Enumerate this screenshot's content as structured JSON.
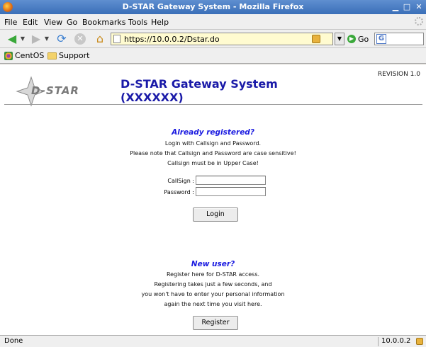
{
  "window": {
    "title": "D-STAR Gateway System - Mozilla Firefox",
    "min_glyph": "▁",
    "max_glyph": "□",
    "close_glyph": "✕"
  },
  "menu": {
    "items": [
      {
        "label": "File",
        "key": "F"
      },
      {
        "label": "Edit",
        "key": "E"
      },
      {
        "label": "View",
        "key": "V"
      },
      {
        "label": "Go",
        "key": "G"
      },
      {
        "label": "Bookmarks",
        "key": "B"
      },
      {
        "label": "Tools",
        "key": "T"
      },
      {
        "label": "Help",
        "key": "H"
      }
    ]
  },
  "toolbar": {
    "url": "https://10.0.0.2/Dstar.do",
    "go_label": "Go",
    "search_glyph": "G"
  },
  "bookmarks": [
    {
      "label": "CentOS",
      "icon": "centos-icon"
    },
    {
      "label": "Support",
      "icon": "folder-icon"
    }
  ],
  "page": {
    "logo_text": "D-STAR",
    "title": "D-STAR Gateway System (XXXXXX)",
    "revision": "REVISION 1.0",
    "login": {
      "heading": "Already registered?",
      "line1": "Login with Callsign and Password.",
      "line2": "Please note that Callsign and Password are case sensitive!",
      "line3": "Callsign must be in Upper Case!",
      "callsign_label": "CallSign :",
      "callsign_value": "",
      "password_label": "Password :",
      "password_value": "",
      "button": "Login"
    },
    "register": {
      "heading": "New user?",
      "line1": "Register here for D-STAR access.",
      "line2": "Registering takes just a few seconds, and",
      "line3": "you won't have to enter your personal information",
      "line4": "again the next time you visit here.",
      "button": "Register"
    }
  },
  "status": {
    "text": "Done",
    "host": "10.0.0.2"
  },
  "colors": {
    "title_blue": "#1a1aa8",
    "heading_blue": "#1a1ae0",
    "titlebar": "#3a6fb8"
  }
}
